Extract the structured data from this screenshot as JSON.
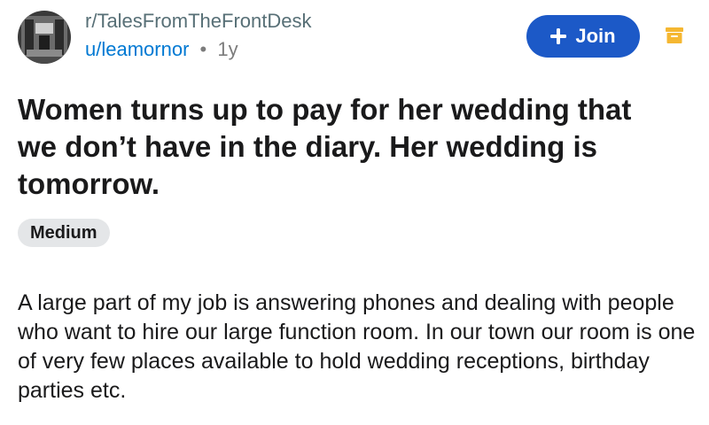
{
  "header": {
    "subreddit": "r/TalesFromTheFrontDesk",
    "username": "u/leamornor",
    "separator": "•",
    "age": "1y",
    "join_label": "Join"
  },
  "icons": {
    "avatar": "subreddit-avatar-icon",
    "join": "plus-icon",
    "archive": "archive-icon"
  },
  "colors": {
    "join_button": "#1c59c7",
    "username": "#0079d3",
    "archive_icon": "#f5b731",
    "flair_background": "#e4e6e8"
  },
  "post": {
    "title": "Women turns up to pay for her wedding that we don’t have in the diary. Her wedding is tomorrow.",
    "flair": "Medium",
    "body": "A large part of my job is answering phones and dealing with people who want to hire our large function room. In our town our room is one of very few places available to hold wedding receptions, birthday parties etc."
  }
}
